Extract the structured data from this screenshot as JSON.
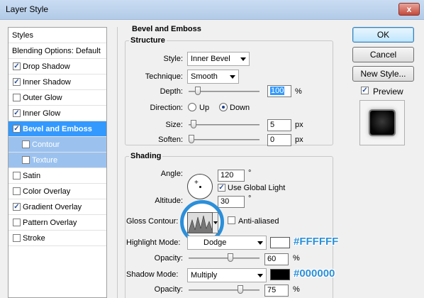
{
  "window": {
    "title": "Layer Style",
    "close_glyph": "x"
  },
  "styles_list": [
    {
      "label": "Styles",
      "checkbox": false,
      "checked": false,
      "state": "header"
    },
    {
      "label": "Blending Options: Default",
      "checkbox": false,
      "checked": false,
      "state": "normal"
    },
    {
      "label": "Drop Shadow",
      "checkbox": true,
      "checked": true,
      "state": "normal"
    },
    {
      "label": "Inner Shadow",
      "checkbox": true,
      "checked": true,
      "state": "normal"
    },
    {
      "label": "Outer Glow",
      "checkbox": true,
      "checked": false,
      "state": "normal"
    },
    {
      "label": "Inner Glow",
      "checkbox": true,
      "checked": true,
      "state": "normal"
    },
    {
      "label": "Bevel and Emboss",
      "checkbox": true,
      "checked": true,
      "state": "selected"
    },
    {
      "label": "Contour",
      "checkbox": true,
      "checked": false,
      "state": "sub"
    },
    {
      "label": "Texture",
      "checkbox": true,
      "checked": false,
      "state": "sub"
    },
    {
      "label": "Satin",
      "checkbox": true,
      "checked": false,
      "state": "normal"
    },
    {
      "label": "Color Overlay",
      "checkbox": true,
      "checked": false,
      "state": "normal"
    },
    {
      "label": "Gradient Overlay",
      "checkbox": true,
      "checked": true,
      "state": "normal"
    },
    {
      "label": "Pattern Overlay",
      "checkbox": true,
      "checked": false,
      "state": "normal"
    },
    {
      "label": "Stroke",
      "checkbox": true,
      "checked": false,
      "state": "normal"
    }
  ],
  "panel": {
    "title": "Bevel and Emboss",
    "structure": {
      "title": "Structure",
      "style_label": "Style:",
      "style_value": "Inner Bevel",
      "technique_label": "Technique:",
      "technique_value": "Smooth",
      "depth_label": "Depth:",
      "depth_value": "100",
      "depth_unit": "%",
      "depth_slider": 0.1,
      "direction_label": "Direction:",
      "direction_up": "Up",
      "direction_down": "Down",
      "direction_selected": "Down",
      "size_label": "Size:",
      "size_value": "5",
      "size_unit": "px",
      "size_slider": 0.03,
      "soften_label": "Soften:",
      "soften_value": "0",
      "soften_unit": "px",
      "soften_slider": 0.0
    },
    "shading": {
      "title": "Shading",
      "angle_label": "Angle:",
      "angle_value": "120",
      "angle_unit": "°",
      "use_global_light_label": "Use Global Light",
      "use_global_light_checked": true,
      "altitude_label": "Altitude:",
      "altitude_value": "30",
      "altitude_unit": "°",
      "gloss_contour_label": "Gloss Contour:",
      "anti_aliased_label": "Anti-aliased",
      "anti_aliased_checked": false,
      "highlight_mode_label": "Highlight Mode:",
      "highlight_mode_value": "Dodge",
      "highlight_color": "#FFFFFF",
      "highlight_hex_label": "#FFFFFF",
      "highlight_opacity_label": "Opacity:",
      "highlight_opacity_value": "60",
      "highlight_opacity_unit": "%",
      "highlight_opacity_slider": 0.6,
      "shadow_mode_label": "Shadow Mode:",
      "shadow_mode_value": "Multiply",
      "shadow_color": "#000000",
      "shadow_hex_label": "#000000",
      "shadow_opacity_label": "Opacity:",
      "shadow_opacity_value": "75",
      "shadow_opacity_unit": "%",
      "shadow_opacity_slider": 0.75
    }
  },
  "buttons": {
    "ok": "OK",
    "cancel": "Cancel",
    "new_style": "New Style...",
    "preview_label": "Preview",
    "preview_checked": true
  },
  "accent_color": "#2B8FD9"
}
